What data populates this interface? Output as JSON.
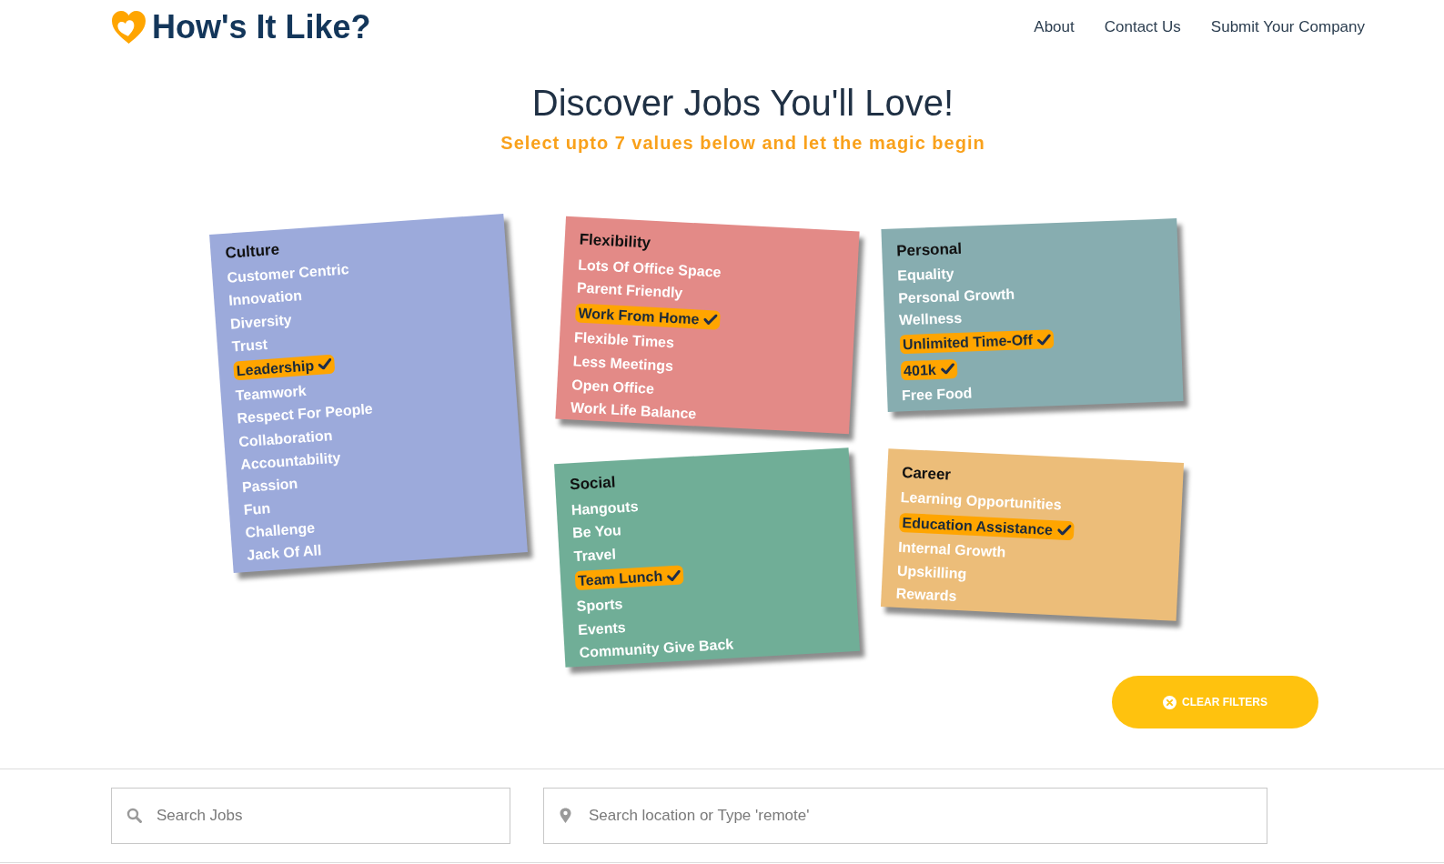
{
  "header": {
    "logo_text": "How's It Like?",
    "nav": [
      "About",
      "Contact Us",
      "Submit Your Company"
    ]
  },
  "hero": {
    "title": "Discover Jobs You'll Love!",
    "subtitle": "Select upto 7 values below and let the magic begin"
  },
  "categories": [
    {
      "title": "Culture",
      "color": "#9caadb",
      "items": [
        {
          "label": "Customer Centric",
          "selected": false
        },
        {
          "label": "Innovation",
          "selected": false
        },
        {
          "label": "Diversity",
          "selected": false
        },
        {
          "label": "Trust",
          "selected": false
        },
        {
          "label": "Leadership",
          "selected": true
        },
        {
          "label": "Teamwork",
          "selected": false
        },
        {
          "label": "Respect For People",
          "selected": false
        },
        {
          "label": "Collaboration",
          "selected": false
        },
        {
          "label": "Accountability",
          "selected": false
        },
        {
          "label": "Passion",
          "selected": false
        },
        {
          "label": "Fun",
          "selected": false
        },
        {
          "label": "Challenge",
          "selected": false
        },
        {
          "label": "Jack Of All",
          "selected": false
        }
      ]
    },
    {
      "title": "Flexibility",
      "color": "#e38a87",
      "items": [
        {
          "label": "Lots Of Office Space",
          "selected": false
        },
        {
          "label": "Parent Friendly",
          "selected": false
        },
        {
          "label": "Work From Home",
          "selected": true
        },
        {
          "label": "Flexible Times",
          "selected": false
        },
        {
          "label": "Less Meetings",
          "selected": false
        },
        {
          "label": "Open Office",
          "selected": false
        },
        {
          "label": "Work Life Balance",
          "selected": false
        }
      ]
    },
    {
      "title": "Personal",
      "color": "#87adb0",
      "items": [
        {
          "label": "Equality",
          "selected": false
        },
        {
          "label": "Personal Growth",
          "selected": false
        },
        {
          "label": "Wellness",
          "selected": false
        },
        {
          "label": "Unlimited Time-Off",
          "selected": true
        },
        {
          "label": "401k",
          "selected": true
        },
        {
          "label": "Free Food",
          "selected": false
        }
      ]
    },
    {
      "title": "Social",
      "color": "#70ae97",
      "items": [
        {
          "label": "Hangouts",
          "selected": false
        },
        {
          "label": "Be You",
          "selected": false
        },
        {
          "label": "Travel",
          "selected": false
        },
        {
          "label": "Team Lunch",
          "selected": true
        },
        {
          "label": "Sports",
          "selected": false
        },
        {
          "label": "Events",
          "selected": false
        },
        {
          "label": "Community Give Back",
          "selected": false
        }
      ]
    },
    {
      "title": "Career",
      "color": "#ecbd79",
      "items": [
        {
          "label": "Learning Opportunities",
          "selected": false
        },
        {
          "label": "Education Assistance",
          "selected": true
        },
        {
          "label": "Internal Growth",
          "selected": false
        },
        {
          "label": "Upskilling",
          "selected": false
        },
        {
          "label": "Rewards",
          "selected": false
        }
      ]
    }
  ],
  "clear_button": {
    "label": "CLEAR FILTERS"
  },
  "search": {
    "jobs": {
      "placeholder": "Search Jobs"
    },
    "location": {
      "placeholder": "Search location or Type 'remote'"
    }
  }
}
